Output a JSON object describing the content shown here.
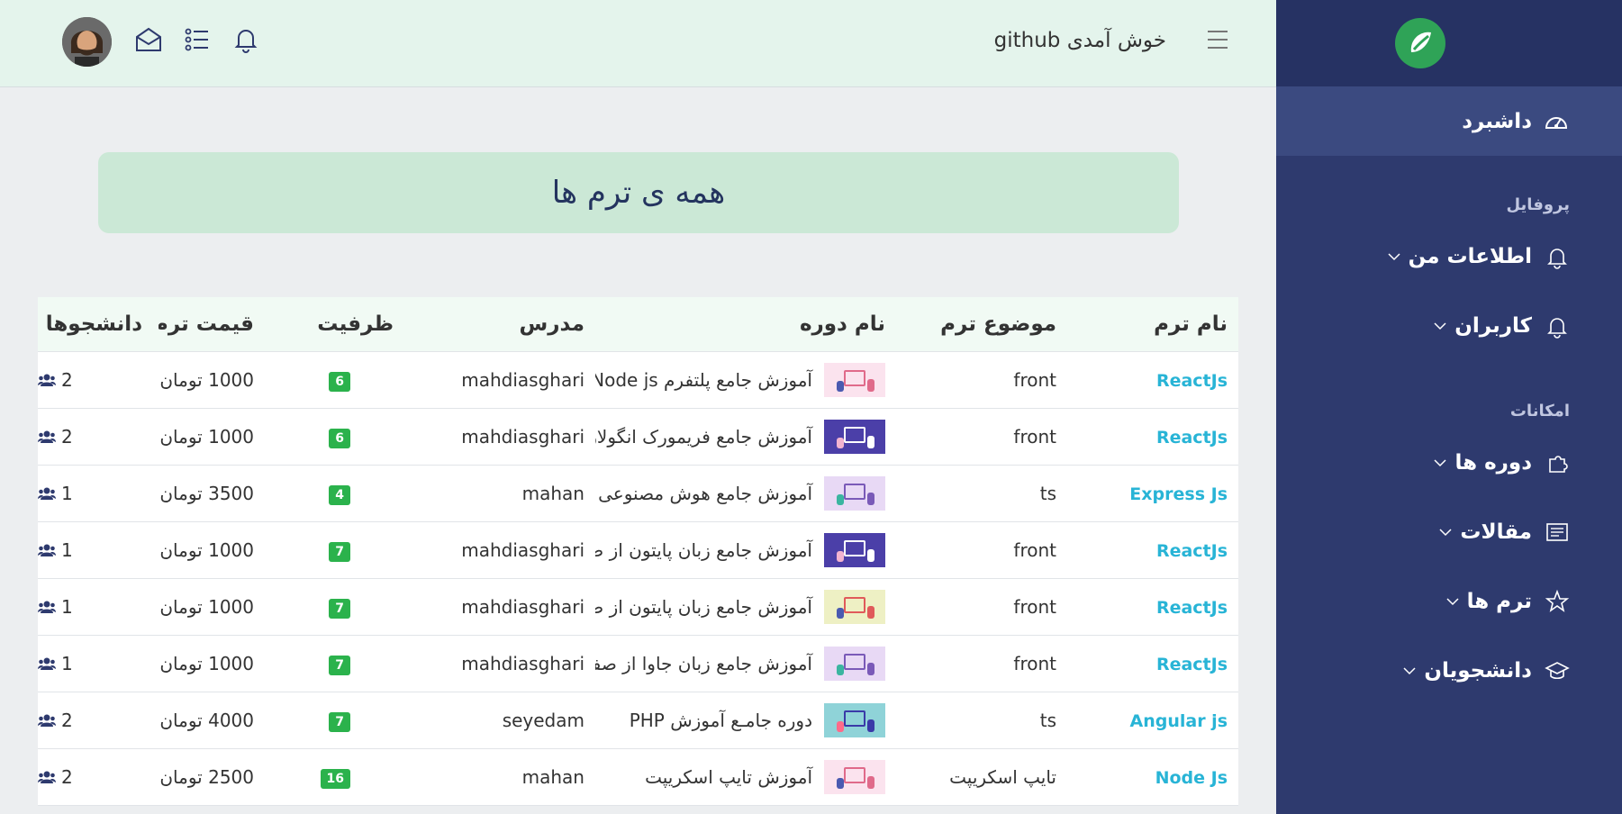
{
  "sidebar": {
    "dashboard": "داشبرد",
    "section_profile": "پروفایل",
    "section_features": "امکانات",
    "items": [
      {
        "label": "اطلاعات من",
        "icon": "bell-icon"
      },
      {
        "label": "کاربران",
        "icon": "bell-icon"
      },
      {
        "label": "دوره ها",
        "icon": "puzzle-icon"
      },
      {
        "label": "مقالات",
        "icon": "article-icon"
      },
      {
        "label": "ترم ها",
        "icon": "star-icon"
      },
      {
        "label": "دانشجویان",
        "icon": "graduation-cap-icon"
      }
    ]
  },
  "header": {
    "welcome": "خوش آمدی github"
  },
  "banner": {
    "title": "همه ی ترم ها"
  },
  "table": {
    "headers": {
      "term": "نام ترم",
      "topic": "موضوع ترم",
      "course": "نام دوره",
      "teacher": "مدرس",
      "capacity": "ظرفیت",
      "price": "قیمت ترم",
      "students": "دانشجوها"
    },
    "rows": [
      {
        "term": "ReactJs",
        "topic": "front",
        "course": "آموزش جامع پلتفرم Node js",
        "thumb": "pink",
        "teacher": "mahdiasghari",
        "capacity": "6",
        "price": "1000 تومان",
        "students": "2"
      },
      {
        "term": "ReactJs",
        "topic": "front",
        "course": "آموزش جامع فریمورک انگولار",
        "thumb": "purple",
        "teacher": "mahdiasghari",
        "capacity": "6",
        "price": "1000 تومان",
        "students": "2"
      },
      {
        "term": "Express Js",
        "topic": "ts",
        "course": "آموزش جامع هوش مصنوعی با جاوا اسکریپت",
        "thumb": "lilac",
        "teacher": "mahan",
        "capacity": "4",
        "price": "3500 تومان",
        "students": "1"
      },
      {
        "term": "ReactJs",
        "topic": "front",
        "course": "آموزش جامع زبان پایتون از صفر تا صد",
        "thumb": "purple",
        "teacher": "mahdiasghari",
        "capacity": "7",
        "price": "1000 تومان",
        "students": "1"
      },
      {
        "term": "ReactJs",
        "topic": "front",
        "course": "آموزش جامع زبان پایتون از صفر تا صد",
        "thumb": "yellow",
        "teacher": "mahdiasghari",
        "capacity": "7",
        "price": "1000 تومان",
        "students": "1"
      },
      {
        "term": "ReactJs",
        "topic": "front",
        "course": "آموزش جامع زبان جاوا از صفر تا صد",
        "thumb": "lilac",
        "teacher": "mahdiasghari",
        "capacity": "7",
        "price": "1000 تومان",
        "students": "1"
      },
      {
        "term": "Angular js",
        "topic": "ts",
        "course": "دوره جامـع آموزش PHP",
        "thumb": "teal",
        "teacher": "seyedam",
        "capacity": "7",
        "price": "4000 تومان",
        "students": "2"
      },
      {
        "term": "Node Js",
        "topic": "تایپ اسکریپت",
        "course": "آموزش تایپ اسکریپت",
        "thumb": "pink",
        "teacher": "mahan",
        "capacity": "16",
        "price": "2500 تومان",
        "students": "2"
      }
    ]
  },
  "colors": {
    "sidebar_bg": "#2e3a6e",
    "header_bg": "#e4f4ec",
    "banner_bg": "#cbe8d6",
    "link": "#28b4d6",
    "badge": "#2bb24c"
  }
}
